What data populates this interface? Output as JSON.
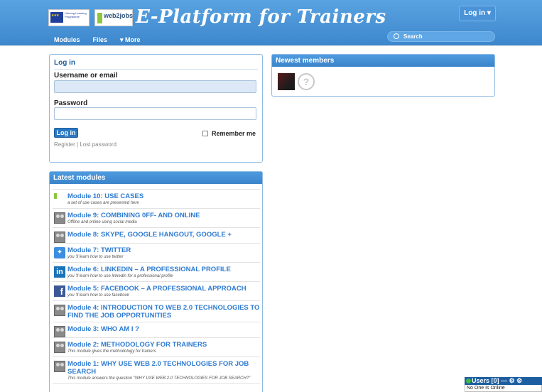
{
  "header": {
    "eu_logo_text": "Lifelong Learning Programme",
    "w2j_logo_text": "web2jobs",
    "site_title": "E-Platform for Trainers",
    "login_menu": "Log in ▾"
  },
  "nav": [
    {
      "label": "Modules"
    },
    {
      "label": "Files"
    },
    {
      "label": "▾ More"
    }
  ],
  "search": {
    "placeholder": "Search"
  },
  "login_panel": {
    "title": "Log in",
    "username_label": "Username or email",
    "username_value": "",
    "password_label": "Password",
    "password_value": "",
    "button": "Log in",
    "remember": "Remember me",
    "register": "Register",
    "separator": "|",
    "lost_password": "Lost password"
  },
  "newest_members": {
    "title": "Newest members",
    "avatars": [
      {
        "icon": "member-photo"
      },
      {
        "icon": "unknown-member",
        "glyph": "?"
      }
    ]
  },
  "latest_modules": {
    "title": "Latest modules",
    "items": [
      {
        "title": "Module 10: USE CASES",
        "desc": "a set of use cases are presented here",
        "icon": "w2e"
      },
      {
        "title": "Module 9: COMBINING 0FF- AND ONLINE",
        "desc": "Offline and online using social media",
        "icon": "people"
      },
      {
        "title": "Module 8: SKYPE, GOOGLE HANGOUT, GOOGLE +",
        "desc": "",
        "icon": "people"
      },
      {
        "title": "Module 7: TWITTER",
        "desc": "you 'll learn how to use twitter",
        "icon": "twitter"
      },
      {
        "title": "Module 6: LINKEDIN – A PROFESSIONAL PROFILE",
        "desc": "you 'll learn how to use linkedin for a professional profile",
        "icon": "linkedin"
      },
      {
        "title": "Module 5: FACEBOOK – A PROFESSIONAL APPROACH",
        "desc": "you 'll learn how to use facebook",
        "icon": "facebook"
      },
      {
        "title": "Module 4: INTRODUCTION TO WEB 2.0 TECHNOLOGIES TO FIND THE JOB OPPORTUNITIES",
        "desc": "",
        "icon": "people"
      },
      {
        "title": "Module 3: WHO AM I ?",
        "desc": "",
        "icon": "people"
      },
      {
        "title": "Module 2: METHODOLOGY FOR TRAINERS",
        "desc": "This module gives the methodology for trainers",
        "icon": "people"
      },
      {
        "title": "Module 1: WHY USE WEB 2.0 TECHNOLOGIES FOR JOB SEARCH",
        "desc": "This module answers the question \"WHY USE WEB 2.0 TECHNOLOGIES FOR JOB SEARCH?\"",
        "icon": "people"
      }
    ]
  },
  "users_widget": {
    "title": "Users [0]",
    "controls": "— ⚙ ⚙",
    "body": "No One Is Online"
  }
}
